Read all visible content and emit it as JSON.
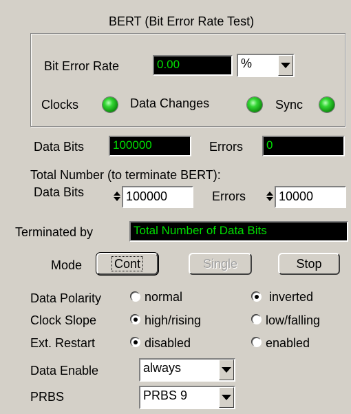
{
  "panel": {
    "title": "BERT (Bit Error Rate Test)",
    "ber_label": "Bit Error Rate",
    "ber_value": "0.00",
    "ber_unit": "%",
    "clocks_label": "Clocks",
    "data_changes_label": "Data Changes",
    "sync_label": "Sync",
    "led_color": "#22cc22"
  },
  "counters": {
    "data_bits_label": "Data Bits",
    "data_bits_value": "100000",
    "errors_label": "Errors",
    "errors_value": "0"
  },
  "terminate": {
    "heading": "Total Number (to terminate BERT):",
    "data_bits_label": "Data Bits",
    "data_bits_value": "100000",
    "errors_label": "Errors",
    "errors_value": "10000",
    "terminated_by_label": "Terminated by",
    "terminated_by_value": "Total Number of Data Bits"
  },
  "mode": {
    "label": "Mode",
    "cont": "Cont",
    "single": "Single",
    "stop": "Stop"
  },
  "options": {
    "data_polarity": {
      "label": "Data Polarity",
      "opt1": "normal",
      "opt2": "inverted",
      "selected": "inverted"
    },
    "clock_slope": {
      "label": "Clock Slope",
      "opt1": "high/rising",
      "opt2": "low/falling",
      "selected": "high/rising"
    },
    "ext_restart": {
      "label": "Ext. Restart",
      "opt1": "disabled",
      "opt2": "enabled",
      "selected": "disabled"
    },
    "data_enable": {
      "label": "Data Enable",
      "value": "always"
    },
    "prbs": {
      "label": "PRBS",
      "value": "PRBS 9"
    }
  },
  "colors": {
    "background": "#d4d0c8",
    "display_bg": "#000000",
    "display_fg": "#00e000"
  }
}
